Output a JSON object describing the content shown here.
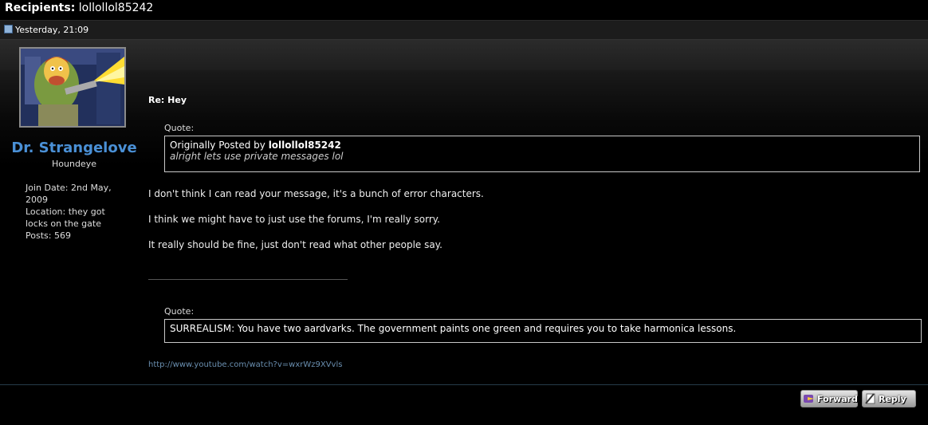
{
  "header": {
    "recipients_label": "Recipients",
    "recipients_value": "lollollol85242",
    "post_date": "Yesterday, 21:09"
  },
  "user": {
    "name": "Dr. Strangelove",
    "title": "Houndeye",
    "join_date": "Join Date: 2nd May, 2009",
    "location": "Location: they got locks on the gate",
    "posts": "Posts: 569"
  },
  "post": {
    "title": "Re: Hey",
    "quote1": {
      "label": "Quote:",
      "prefix": "Originally Posted by",
      "poster": "lollollol85242",
      "text": "alright lets use private messages lol"
    },
    "paragraphs": [
      "I don't think I can read your message, it's a bunch of error characters.",
      "I think we might have to just use the forums, I'm really sorry.",
      "It really should be fine, just don't read what other people say."
    ],
    "quote2": {
      "label": "Quote:",
      "text": "SURREALISM: You have two aardvarks. The government paints one green and requires you to take harmonica lessons."
    },
    "link": "http://www.youtube.com/watch?v=wxrWz9XVvls"
  },
  "actions": {
    "forward_label": "Forward",
    "reply_label": "Reply"
  },
  "colors": {
    "username": "#4a90d6",
    "link": "#6a8fb0"
  },
  "icons": {
    "post": "post-icon",
    "forward": "forward-icon",
    "reply": "reply-icon"
  }
}
